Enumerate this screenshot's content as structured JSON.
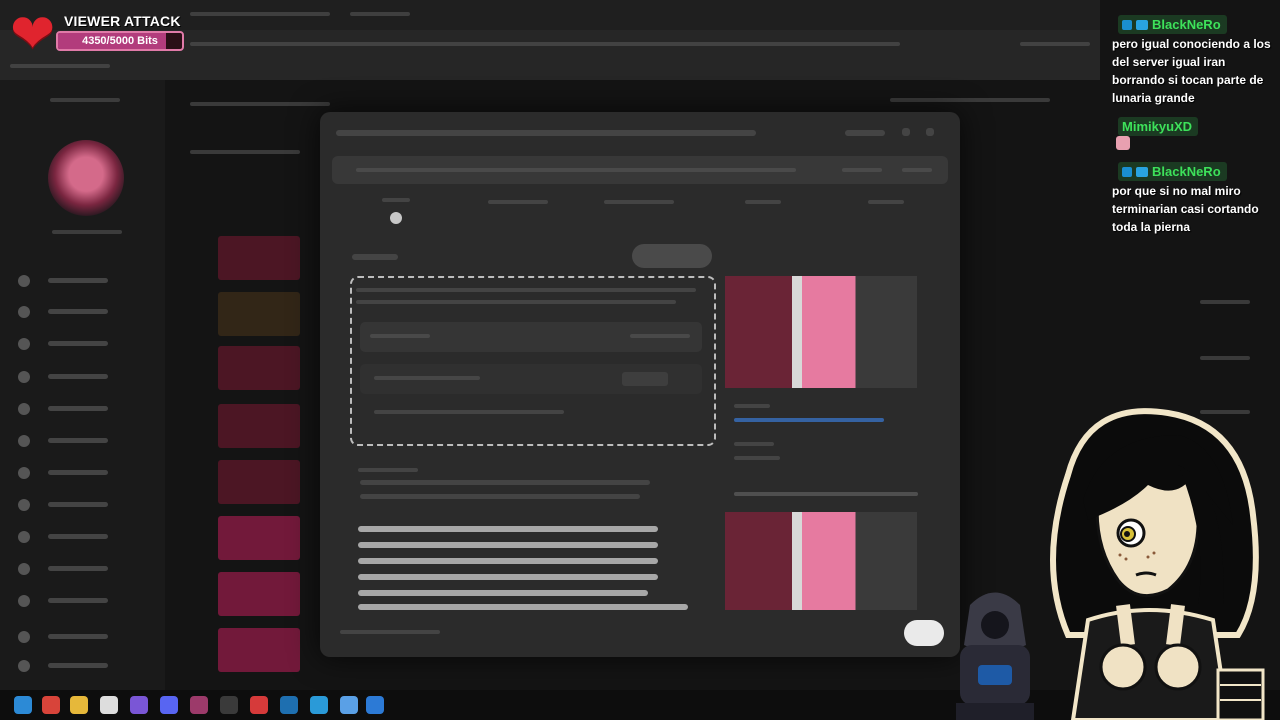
{
  "overlay": {
    "title": "VIEWER ATTACK",
    "bits_text": "4350/5000 Bits",
    "bits_current": 4350,
    "bits_goal": 5000,
    "heart_icon": "heart-icon",
    "colors": {
      "heart": "#e0242e",
      "bar_fill": "#b23c7c",
      "bar_border": "#e07aa8"
    }
  },
  "chat": {
    "messages": [
      {
        "user": "BlackNeRo",
        "text": "pero igual conociendo a los del server igual iran borrando si tocan parte de lunaria grande"
      },
      {
        "user": "MimikyuXD",
        "text": ""
      },
      {
        "user": "BlackNeRo",
        "text": "por que si no mal miro terminarian casi cortando toda la pierna"
      }
    ],
    "colors": {
      "username": "#3de15a",
      "name_bg": "#1b3a22"
    }
  },
  "taskbar": {
    "icons": [
      "settings-icon",
      "chrome-icon",
      "folder-icon",
      "app-icon",
      "game-icon",
      "discord-icon",
      "stream-icon",
      "media-icon",
      "record-icon",
      "terminal-icon",
      "photo-icon",
      "tool-icon"
    ]
  }
}
